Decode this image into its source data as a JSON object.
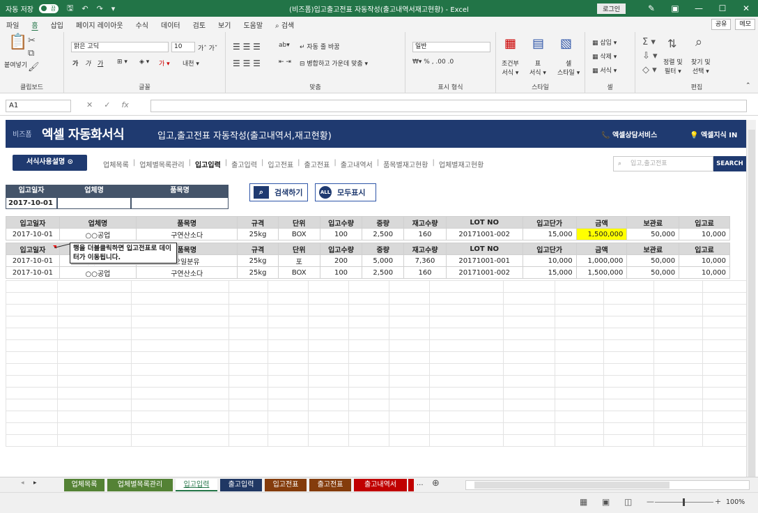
{
  "titlebar": {
    "autosave_label": "자동 저장",
    "autosave_state": "끔",
    "title": "(비즈폼)입고출고전표 자동작성(출고내역서재고현황) - Excel",
    "login": "로그인"
  },
  "menu": {
    "tabs": [
      "파일",
      "홈",
      "삽입",
      "페이지 레이아웃",
      "수식",
      "데이터",
      "검토",
      "보기",
      "도움말",
      "검색"
    ],
    "share": "공유",
    "memo": "메모"
  },
  "ribbon": {
    "paste": "붙여넣기",
    "clipboard": "클립보드",
    "font_name": "맑은 고딕",
    "font_size": "10",
    "font_group": "글꼴",
    "wrap": "자동 줄 바꿈",
    "merge": "병합하고 가운데 맞춤",
    "align_group": "맞춤",
    "number_format": "일반",
    "number_group": "표시 형식",
    "cond_fmt": "조건부",
    "cond_fmt2": "서식",
    "table_fmt": "표",
    "table_fmt2": "서식",
    "cell_style": "셀",
    "cell_style2": "스타일",
    "style_group": "스타일",
    "insert": "삽입",
    "delete": "삭제",
    "format": "서식",
    "cell_group": "셀",
    "sort": "정렬 및",
    "sort2": "필터",
    "find": "찾기 및",
    "find2": "선택",
    "edit_group": "편집"
  },
  "formula": {
    "name_box": "A1",
    "fx": "fx",
    "value": ""
  },
  "banner": {
    "brand_small": "비즈폼",
    "brand": "엑셀 자동화서식",
    "subtitle": "입고,출고전표 자동작성(출고내역서,재고현황)",
    "service": "엑셀상담서비스",
    "knowledge": "엑셀지식 IN"
  },
  "nav": {
    "guide_button": "서식사용설명",
    "links": [
      "업체목록",
      "업체별목록관리",
      "입고입력",
      "출고입력",
      "입고전표",
      "출고전표",
      "출고내역서",
      "품목별재고현황",
      "업체별재고현황"
    ],
    "current": "입고입력",
    "search_placeholder": "입고,출고전표",
    "search_button": "SEARCH"
  },
  "filter": {
    "headers": [
      "입고일자",
      "업체명",
      "품목명"
    ],
    "values": [
      "2017-10-01",
      "",
      ""
    ]
  },
  "buttons": {
    "search": "검색하기",
    "show_all": "모두표시",
    "all_icon_text": "ALL"
  },
  "columns": [
    "입고일자",
    "업체명",
    "품목명",
    "규격",
    "단위",
    "입고수량",
    "중량",
    "재고수량",
    "LOT NO",
    "입고단가",
    "금액",
    "보관료",
    "입고료"
  ],
  "selected_row": [
    "2017-10-01",
    "○○공업",
    "구연산소다",
    "25kg",
    "BOX",
    "100",
    "2,500",
    "160",
    "20171001-002",
    "15,000",
    "1,500,000",
    "50,000",
    "10,000"
  ],
  "list_rows": [
    [
      "2017-10-01",
      "○○공업",
      "오일분유",
      "25kg",
      "포",
      "200",
      "5,000",
      "7,360",
      "20171001-001",
      "10,000",
      "1,000,000",
      "50,000",
      "10,000"
    ],
    [
      "2017-10-01",
      "○○공업",
      "구연산소다",
      "25kg",
      "BOX",
      "100",
      "2,500",
      "160",
      "20171001-002",
      "15,000",
      "1,500,000",
      "50,000",
      "10,000"
    ]
  ],
  "comment": "행을 더블클릭하면 입고전표로 데이터가 이동됩니다.",
  "sheet_tabs": [
    {
      "label": "업체목록",
      "color": "#548235"
    },
    {
      "label": "업체별목록관리",
      "color": "#548235"
    },
    {
      "label": "입고입력",
      "color": "#ffffff"
    },
    {
      "label": "출고입력",
      "color": "#203864"
    },
    {
      "label": "입고전표",
      "color": "#843c0c"
    },
    {
      "label": "출고전표",
      "color": "#843c0c"
    },
    {
      "label": "출고내역서",
      "color": "#c00000"
    }
  ],
  "status": {
    "zoom": "100%"
  },
  "colors": {
    "excel_green": "#227447",
    "banner_navy": "#1f3a70",
    "highlight": "#ffff00"
  }
}
